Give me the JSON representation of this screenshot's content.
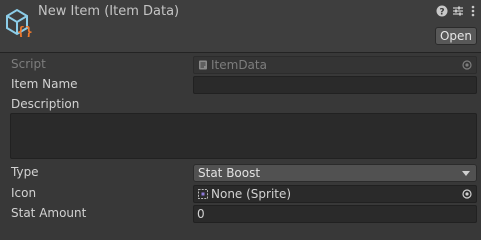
{
  "header": {
    "title": "New Item (Item Data)",
    "open_label": "Open"
  },
  "fields": {
    "script": {
      "label": "Script",
      "value": "ItemData"
    },
    "item_name": {
      "label": "Item Name",
      "value": ""
    },
    "description": {
      "label": "Description",
      "value": ""
    },
    "type": {
      "label": "Type",
      "value": "Stat Boost"
    },
    "icon": {
      "label": "Icon",
      "value": "None (Sprite)"
    },
    "stat_amount": {
      "label": "Stat Amount",
      "value": "0"
    }
  },
  "icons": {
    "asset": "scriptable-object-icon",
    "help": "help-icon",
    "presets": "presets-icon",
    "menu": "kebab-menu-icon",
    "script_file": "script-file-icon",
    "sprite": "sprite-icon",
    "picker": "object-picker-icon",
    "dropdown": "chevron-down-icon"
  },
  "colors": {
    "background": "#383838",
    "header": "#3e3e3e",
    "field": "#2a2a2a",
    "accent_orange": "#f07a2e",
    "accent_blue": "#6fb7e6"
  }
}
